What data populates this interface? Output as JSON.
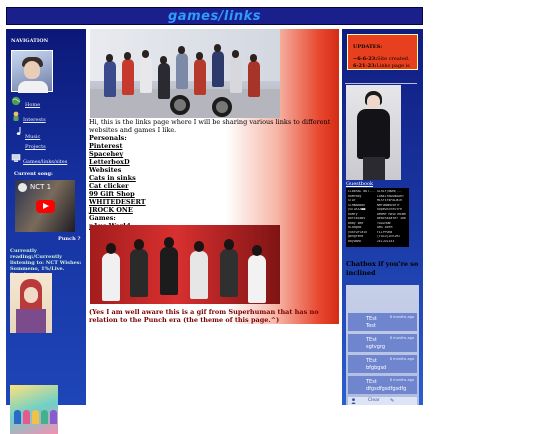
{
  "header": {
    "title": "games/links"
  },
  "left_sidebar": {
    "nav_heading": "NAVIGATION",
    "nav": [
      {
        "label": "Home",
        "icon": "globe-icon"
      },
      {
        "label": "Interests",
        "icon": "character-icon"
      },
      {
        "label": "Music",
        "icon": "music-note-icon"
      },
      {
        "label": "Projects",
        "icon": ""
      },
      {
        "label": "Games/links/sites",
        "icon": "computer-icon"
      }
    ],
    "current_song_label": "Current song:",
    "video_title": "NCT 1",
    "video_caption": "Punch ?",
    "reading": "Currently reading:/Currently listening to: NCT Wishes: Sommeno, 1%/Live. Steady",
    "brand_colors": {
      "background": "#15309e",
      "video_play": "#ff0000"
    }
  },
  "main": {
    "intro": "Hi, this is the links page where I will be sharing various links to different websites and games I like.",
    "sections": [
      {
        "heading": "Personals:",
        "links": [
          "Pinterest",
          "Spacehey",
          "LetterboxD"
        ]
      },
      {
        "heading": "Websites",
        "links": [
          "Cats in sinks",
          "Cat clicker",
          "99 Gift Shop",
          "WHITEDESERT",
          "JROCK ONE"
        ]
      },
      {
        "heading": "Games:",
        "links": [
          "p1us World"
        ]
      }
    ],
    "caption": "(Yes I am well aware this is a gif from Superhuman that has no relation to the Punch era (the theme of this page.^)"
  },
  "right_sidebar": {
    "updates": {
      "heading": "UPDATES:",
      "items": [
        {
          "date": "~6-6-23:",
          "text": "Site created."
        },
        {
          "date": "6-21-23:",
          "text": "Links page is"
        }
      ]
    },
    "guestbook_label": "Guestbook",
    "guestbook_rows": [
      [
        "LIBERAL NOT...",
        "GIRLY/NOHE..."
      ],
      [
        "RUMYBoy",
        "LONELYBOUNDARY"
      ],
      [
        "STAY",
        "MisfitsPALWIR"
      ],
      [
        "SCHWAmoon",
        "NMFUNBRUSHTF"
      ],
      [
        "yuTOXXX■■",
        "hopeOnTheStre"
      ],
      [
        "RUMYy",
        "DMRMP HAVETHEWR"
      ],
      [
        "bottbibbs",
        "beachskater 30000"
      ],
      [
        "baby bee",
        "YAOZHUW"
      ],
      [
        "hCdRgoo",
        "OMG 4NYM"
      ],
      [
        "yukYOPlain",
        "FLIPPOnd"
      ],
      [
        "gangrene",
        "(FACU)ZERIMI"
      ],
      [
        "boyOBRE",
        "ZEIJU1343"
      ]
    ],
    "chat_heading": "Chatbox if you're so inclined",
    "chat_messages": [
      {
        "name": "TEst",
        "time": "8 months ago",
        "text": "Test"
      },
      {
        "name": "TEst",
        "time": "8 months ago",
        "text": "sgtvgrg"
      },
      {
        "name": "TEst",
        "time": "8 months ago",
        "text": "bfgbgsd"
      },
      {
        "name": "TEst",
        "time": "8 months ago",
        "text": "dfgsdfgsdfgsdfg"
      }
    ],
    "chat_bar": {
      "user_icon": "user-icon",
      "clear": "Clear",
      "edit_icon": "edit-icon"
    }
  }
}
